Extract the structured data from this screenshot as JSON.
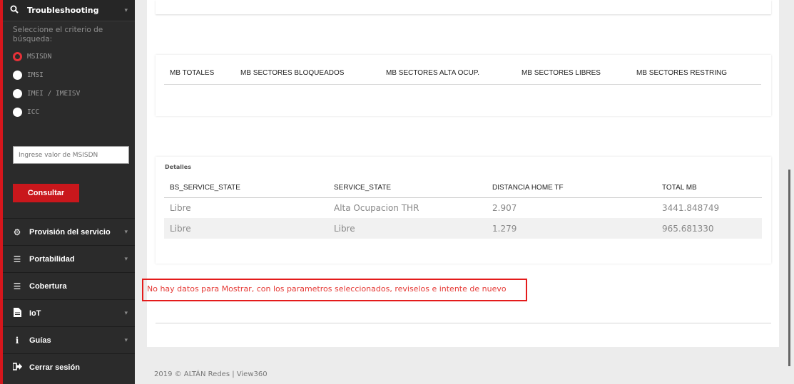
{
  "sidebar": {
    "section_title": "Troubleshooting",
    "prompt": "Seleccione el criterio de búsqueda:",
    "options": [
      {
        "label": "MSISDN",
        "checked": true
      },
      {
        "label": "IMSI",
        "checked": false
      },
      {
        "label": "IMEI / IMEISV",
        "checked": false
      },
      {
        "label": "ICC",
        "checked": false
      }
    ],
    "input_placeholder": "Ingrese valor de MSISDN",
    "consult_button": "Consultar",
    "menu": [
      {
        "label": "Provisión del servicio",
        "icon": "cogs-icon",
        "has_chevron": true
      },
      {
        "label": "Portabilidad",
        "icon": "sliders-icon",
        "has_chevron": true
      },
      {
        "label": "Cobertura",
        "icon": "sliders-icon",
        "has_chevron": false
      },
      {
        "label": "IoT",
        "icon": "file-icon",
        "has_chevron": true
      },
      {
        "label": "Guías",
        "icon": "info-icon",
        "has_chevron": true
      },
      {
        "label": "Cerrar sesión",
        "icon": "sign-out-icon",
        "has_chevron": false
      }
    ],
    "accent_color": "#d6161c"
  },
  "mb_table": {
    "headers": [
      "MB TOTALES",
      "MB SECTORES BLOQUEADOS",
      "MB SECTORES ALTA OCUP.",
      "MB SECTORES LIBRES",
      "MB SECTORES RESTRING"
    ]
  },
  "details": {
    "title": "Detalles",
    "headers": [
      "BS_SERVICE_STATE",
      "SERVICE_STATE",
      "DISTANCIA HOME TF",
      "TOTAL MB"
    ],
    "rows": [
      [
        "Libre",
        "Alta Ocupacion THR",
        "2.907",
        "3441.848749"
      ],
      [
        "Libre",
        "Libre",
        "1.279",
        "965.681330"
      ]
    ]
  },
  "error_message": "No hay datos para Mostrar, con los parametros seleccionados, reviselos e intente de nuevo",
  "footer": "2019 © ALTÁN Redes | View360"
}
